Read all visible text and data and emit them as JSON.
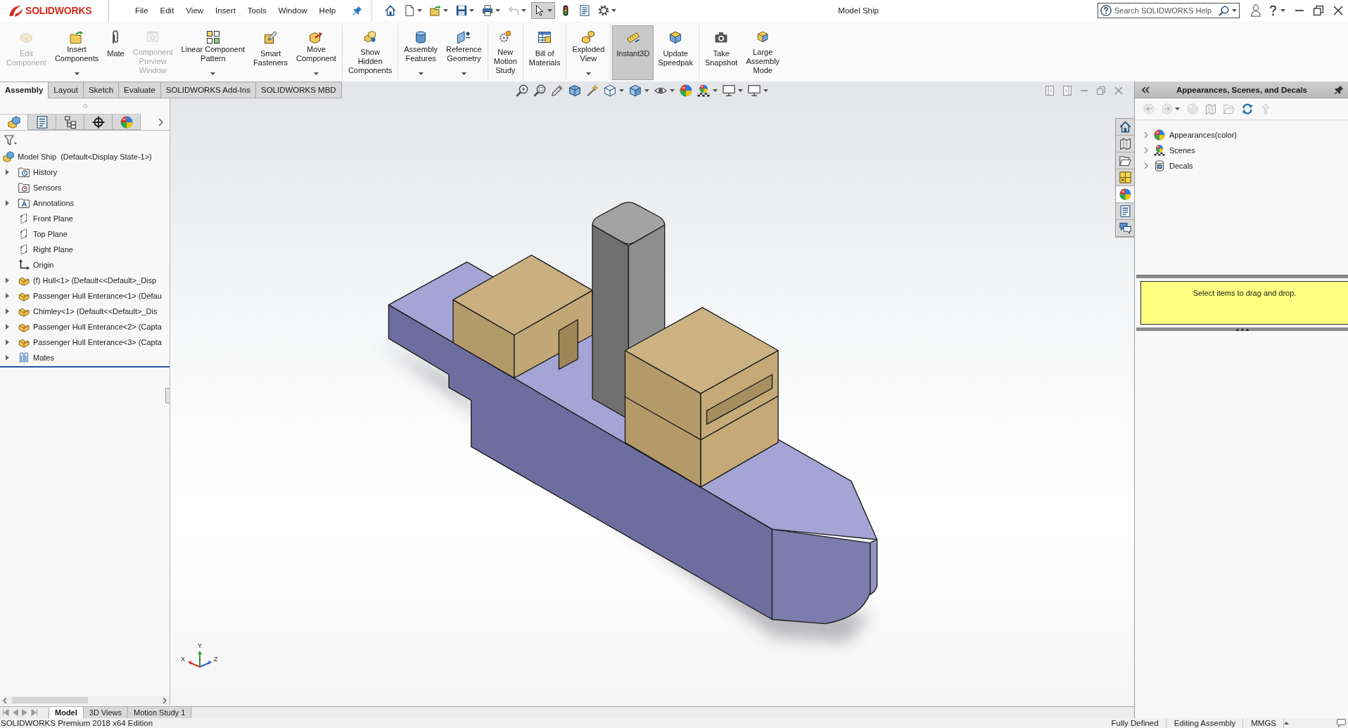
{
  "window": {
    "title": "Model Ship"
  },
  "logo": "SOLIDWORKS",
  "menu": [
    "File",
    "Edit",
    "View",
    "Insert",
    "Tools",
    "Window",
    "Help"
  ],
  "quick_access": [
    {
      "kind": "home",
      "dropdown": false,
      "selected": false,
      "disabled": false
    },
    {
      "kind": "new",
      "dropdown": true,
      "selected": false,
      "disabled": false
    },
    {
      "kind": "open",
      "dropdown": true,
      "selected": false,
      "disabled": false
    },
    {
      "kind": "save",
      "dropdown": true,
      "selected": false,
      "disabled": false
    },
    {
      "kind": "print",
      "dropdown": true,
      "selected": false,
      "disabled": false
    },
    {
      "kind": "undo",
      "dropdown": true,
      "selected": false,
      "disabled": true
    },
    {
      "kind": "select",
      "dropdown": true,
      "selected": true,
      "disabled": false
    },
    {
      "kind": "rebuild",
      "dropdown": false,
      "selected": false,
      "disabled": false
    },
    {
      "kind": "properties",
      "dropdown": false,
      "selected": false,
      "disabled": false
    },
    {
      "kind": "options",
      "dropdown": true,
      "selected": false,
      "disabled": false
    }
  ],
  "search": {
    "placeholder": "Search SOLIDWORKS Help"
  },
  "command_groups": [
    [
      {
        "kind": "edit",
        "label": "Edit\nComponent",
        "disabled": true,
        "dropdown": false,
        "active": false
      },
      {
        "kind": "insert",
        "label": "Insert\nComponents",
        "disabled": false,
        "dropdown": true,
        "active": false
      },
      {
        "kind": "mate",
        "label": "Mate",
        "disabled": false,
        "dropdown": false,
        "active": false
      },
      {
        "kind": "preview",
        "label": "Component\nPreview\nWindow",
        "disabled": true,
        "dropdown": false,
        "active": false
      },
      {
        "kind": "pattern",
        "label": "Linear Component\nPattern",
        "disabled": false,
        "dropdown": true,
        "active": false
      },
      {
        "kind": "fasteners",
        "label": "Smart\nFasteners",
        "disabled": false,
        "dropdown": false,
        "active": false
      },
      {
        "kind": "move",
        "label": "Move\nComponent",
        "disabled": false,
        "dropdown": true,
        "active": false
      }
    ],
    [
      {
        "kind": "hidden",
        "label": "Show\nHidden\nComponents",
        "disabled": false,
        "dropdown": false,
        "active": false
      }
    ],
    [
      {
        "kind": "features",
        "label": "Assembly\nFeatures",
        "disabled": false,
        "dropdown": true,
        "active": false
      },
      {
        "kind": "reference",
        "label": "Reference\nGeometry",
        "disabled": false,
        "dropdown": true,
        "active": false
      }
    ],
    [
      {
        "kind": "motion",
        "label": "New\nMotion\nStudy",
        "disabled": false,
        "dropdown": false,
        "active": false
      }
    ],
    [
      {
        "kind": "bom",
        "label": "Bill of\nMaterials",
        "disabled": false,
        "dropdown": false,
        "active": false
      }
    ],
    [
      {
        "kind": "explode",
        "label": "Exploded\nView",
        "disabled": false,
        "dropdown": true,
        "active": false
      }
    ],
    [
      {
        "kind": "instant3d",
        "label": "Instant3D",
        "disabled": false,
        "dropdown": false,
        "active": true
      },
      {
        "kind": "speedpak",
        "label": "Update\nSpeedpak",
        "disabled": false,
        "dropdown": false,
        "active": false
      }
    ],
    [
      {
        "kind": "snapshot",
        "label": "Take\nSnapshot",
        "disabled": false,
        "dropdown": false,
        "active": false
      },
      {
        "kind": "large",
        "label": "Large\nAssembly\nMode",
        "disabled": false,
        "dropdown": false,
        "active": false
      }
    ]
  ],
  "command_tabs": [
    {
      "label": "Assembly",
      "selected": true
    },
    {
      "label": "Layout",
      "selected": false
    },
    {
      "label": "Sketch",
      "selected": false
    },
    {
      "label": "Evaluate",
      "selected": false
    },
    {
      "label": "SOLIDWORKS Add-Ins",
      "selected": false
    },
    {
      "label": "SOLIDWORKS MBD",
      "selected": false
    }
  ],
  "manager_tabs": [
    {
      "kind": "tree",
      "selected": true
    },
    {
      "kind": "property",
      "selected": false
    },
    {
      "kind": "configuration",
      "selected": false
    },
    {
      "kind": "dimxpert",
      "selected": false
    },
    {
      "kind": "display",
      "selected": false
    }
  ],
  "feature_tree": {
    "label": "Model Ship  (Default<Display State-1>)",
    "kind": "assembly",
    "children": [
      {
        "label": "History",
        "kind": "history",
        "expandable": true
      },
      {
        "label": "Sensors",
        "kind": "sensors",
        "expandable": false
      },
      {
        "label": "Annotations",
        "kind": "annotations",
        "expandable": true
      },
      {
        "label": "Front Plane",
        "kind": "plane",
        "expandable": false
      },
      {
        "label": "Top Plane",
        "kind": "plane",
        "expandable": false
      },
      {
        "label": "Right Plane",
        "kind": "plane",
        "expandable": false
      },
      {
        "label": "Origin",
        "kind": "origin",
        "expandable": false
      },
      {
        "label": "(f) Hull<1> (Default<<Default>_Disp",
        "kind": "part",
        "expandable": true
      },
      {
        "label": "Passenger Hull Enterance<1> (Defau",
        "kind": "part",
        "expandable": true
      },
      {
        "label": "Chimley<1> (Default<<Default>_Dis",
        "kind": "part",
        "expandable": true
      },
      {
        "label": "Passenger Hull Enterance<2> (Capta",
        "kind": "part",
        "expandable": true
      },
      {
        "label": "Passenger Hull Enterance<3> (Capta",
        "kind": "part",
        "expandable": true
      },
      {
        "label": "Mates",
        "kind": "mates",
        "expandable": true
      }
    ]
  },
  "triad": {
    "x": "X",
    "y": "Y",
    "z": "Z"
  },
  "task_pane_tabs": [
    {
      "kind": "home",
      "selected": false
    },
    {
      "kind": "library",
      "selected": false
    },
    {
      "kind": "explorer",
      "selected": false
    },
    {
      "kind": "palette",
      "selected": false
    },
    {
      "kind": "appearances",
      "selected": true
    },
    {
      "kind": "properties",
      "selected": false
    },
    {
      "kind": "forum",
      "selected": false
    }
  ],
  "task_pane": {
    "title": "Appearances, Scenes, and Decals",
    "toolbar": [
      {
        "kind": "back",
        "disabled": true,
        "dropdown": false
      },
      {
        "kind": "forward",
        "disabled": true,
        "dropdown": true
      },
      {
        "kind": "appearance",
        "disabled": true,
        "dropdown": false
      },
      {
        "kind": "library",
        "disabled": true,
        "dropdown": false
      },
      {
        "kind": "folder",
        "disabled": true,
        "dropdown": false
      },
      {
        "kind": "refresh",
        "disabled": false,
        "dropdown": false
      },
      {
        "kind": "up",
        "disabled": true,
        "dropdown": false
      }
    ],
    "items": [
      {
        "label": "Appearances(color)",
        "kind": "appearances",
        "expanded": false
      },
      {
        "label": "Scenes",
        "kind": "scenes",
        "expanded": false
      },
      {
        "label": "Decals",
        "kind": "decals",
        "expanded": false
      }
    ],
    "hint": "Select items to drag and drop."
  },
  "document_tabs": [
    {
      "label": "Model",
      "selected": true
    },
    {
      "label": "3D Views",
      "selected": false
    },
    {
      "label": "Motion Study 1",
      "selected": false
    }
  ],
  "status_bar": {
    "edition": "SOLIDWORKS Premium 2018 x64 Edition",
    "items": [
      "Fully Defined",
      "Editing Assembly",
      "MMGS"
    ]
  }
}
